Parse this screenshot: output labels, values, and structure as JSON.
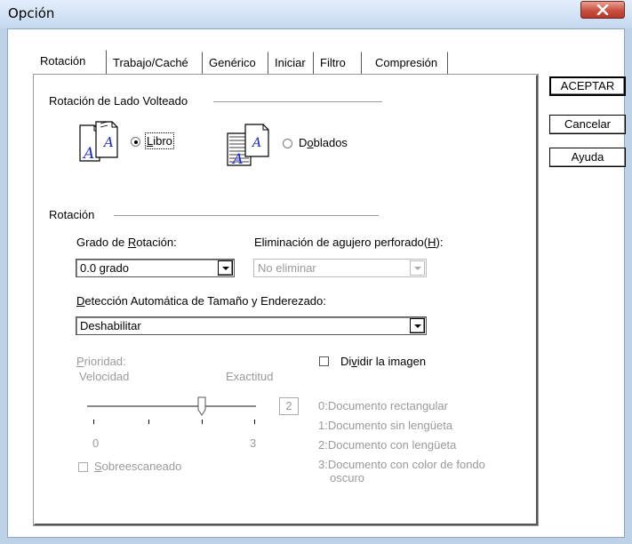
{
  "window": {
    "title": "Opción",
    "close_label": "X"
  },
  "tabs": [
    {
      "label": "Rotación",
      "active": true
    },
    {
      "label": "Trabajo/Caché"
    },
    {
      "label": "Genérico"
    },
    {
      "label": "Iniciar"
    },
    {
      "label": "Filtro"
    },
    {
      "label": "Compresión"
    }
  ],
  "buttons": {
    "accept": "ACEPTAR",
    "cancel": "Cancelar",
    "help": "Ayuda"
  },
  "flip_group": {
    "title": "Rotación de Lado Volteado",
    "book": {
      "pre": "",
      "ul": "L",
      "post": "ibro",
      "selected": true
    },
    "fold": {
      "pre": "D",
      "ul": "o",
      "post": "blados",
      "selected": false
    }
  },
  "rotation_group": {
    "title": "Rotación",
    "degree_label": {
      "pre": "Grado de ",
      "ul": "R",
      "post": "otación:"
    },
    "degree_value": "0.0 grado",
    "punch_label": {
      "pre": "Eliminación de agujero perforado(",
      "ul": "H",
      "post": "):"
    },
    "punch_value": "No eliminar",
    "auto_label": {
      "pre": "",
      "ul": "D",
      "post": "etección Automática de Tamaño y Enderezado:"
    },
    "auto_value": "Deshabilitar",
    "priority_label": {
      "pre": "",
      "ul": "P",
      "post": "rioridad:"
    },
    "speed_label": "Velocidad",
    "accuracy_label": "Exactitud",
    "slider_value": 2,
    "slider_min_label": "0",
    "slider_max_label": "3",
    "split_label": {
      "pre": "Di",
      "ul": "v",
      "post": "idir la imagen"
    },
    "overscan_label": {
      "pre": "",
      "ul": "S",
      "post": "obreescaneado"
    },
    "legend": [
      "0:Documento rectangular",
      "1:Documento sin lengüeta",
      "2:Documento con lengüeta",
      "3:Documento con color de fondo",
      "oscuro"
    ]
  }
}
